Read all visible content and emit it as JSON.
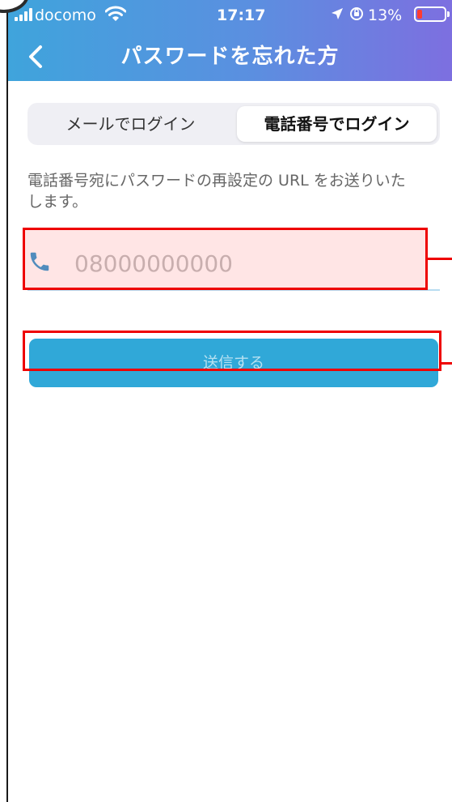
{
  "status_bar": {
    "carrier": "docomo",
    "time": "17:17",
    "battery_percent": "13%",
    "battery_level": 0.13
  },
  "nav": {
    "title": "パスワードを忘れた方",
    "back_icon": "chevron-left-icon"
  },
  "tabs": [
    {
      "label": "メールでログイン",
      "selected": false
    },
    {
      "label": "電話番号でログイン",
      "selected": true
    }
  ],
  "description": "電話番号宛にパスワードの再設定の URL をお送りいたします。",
  "phone_input": {
    "value": "",
    "placeholder": "08000000000",
    "icon": "phone-icon"
  },
  "send_button": {
    "label": "送信する"
  },
  "colors": {
    "header_gradient_start": "#3fa4dc",
    "header_gradient_end": "#7d6fe0",
    "button": "#30a8d8",
    "phone_icon": "#2b93cf",
    "highlight": "#ee0000"
  }
}
